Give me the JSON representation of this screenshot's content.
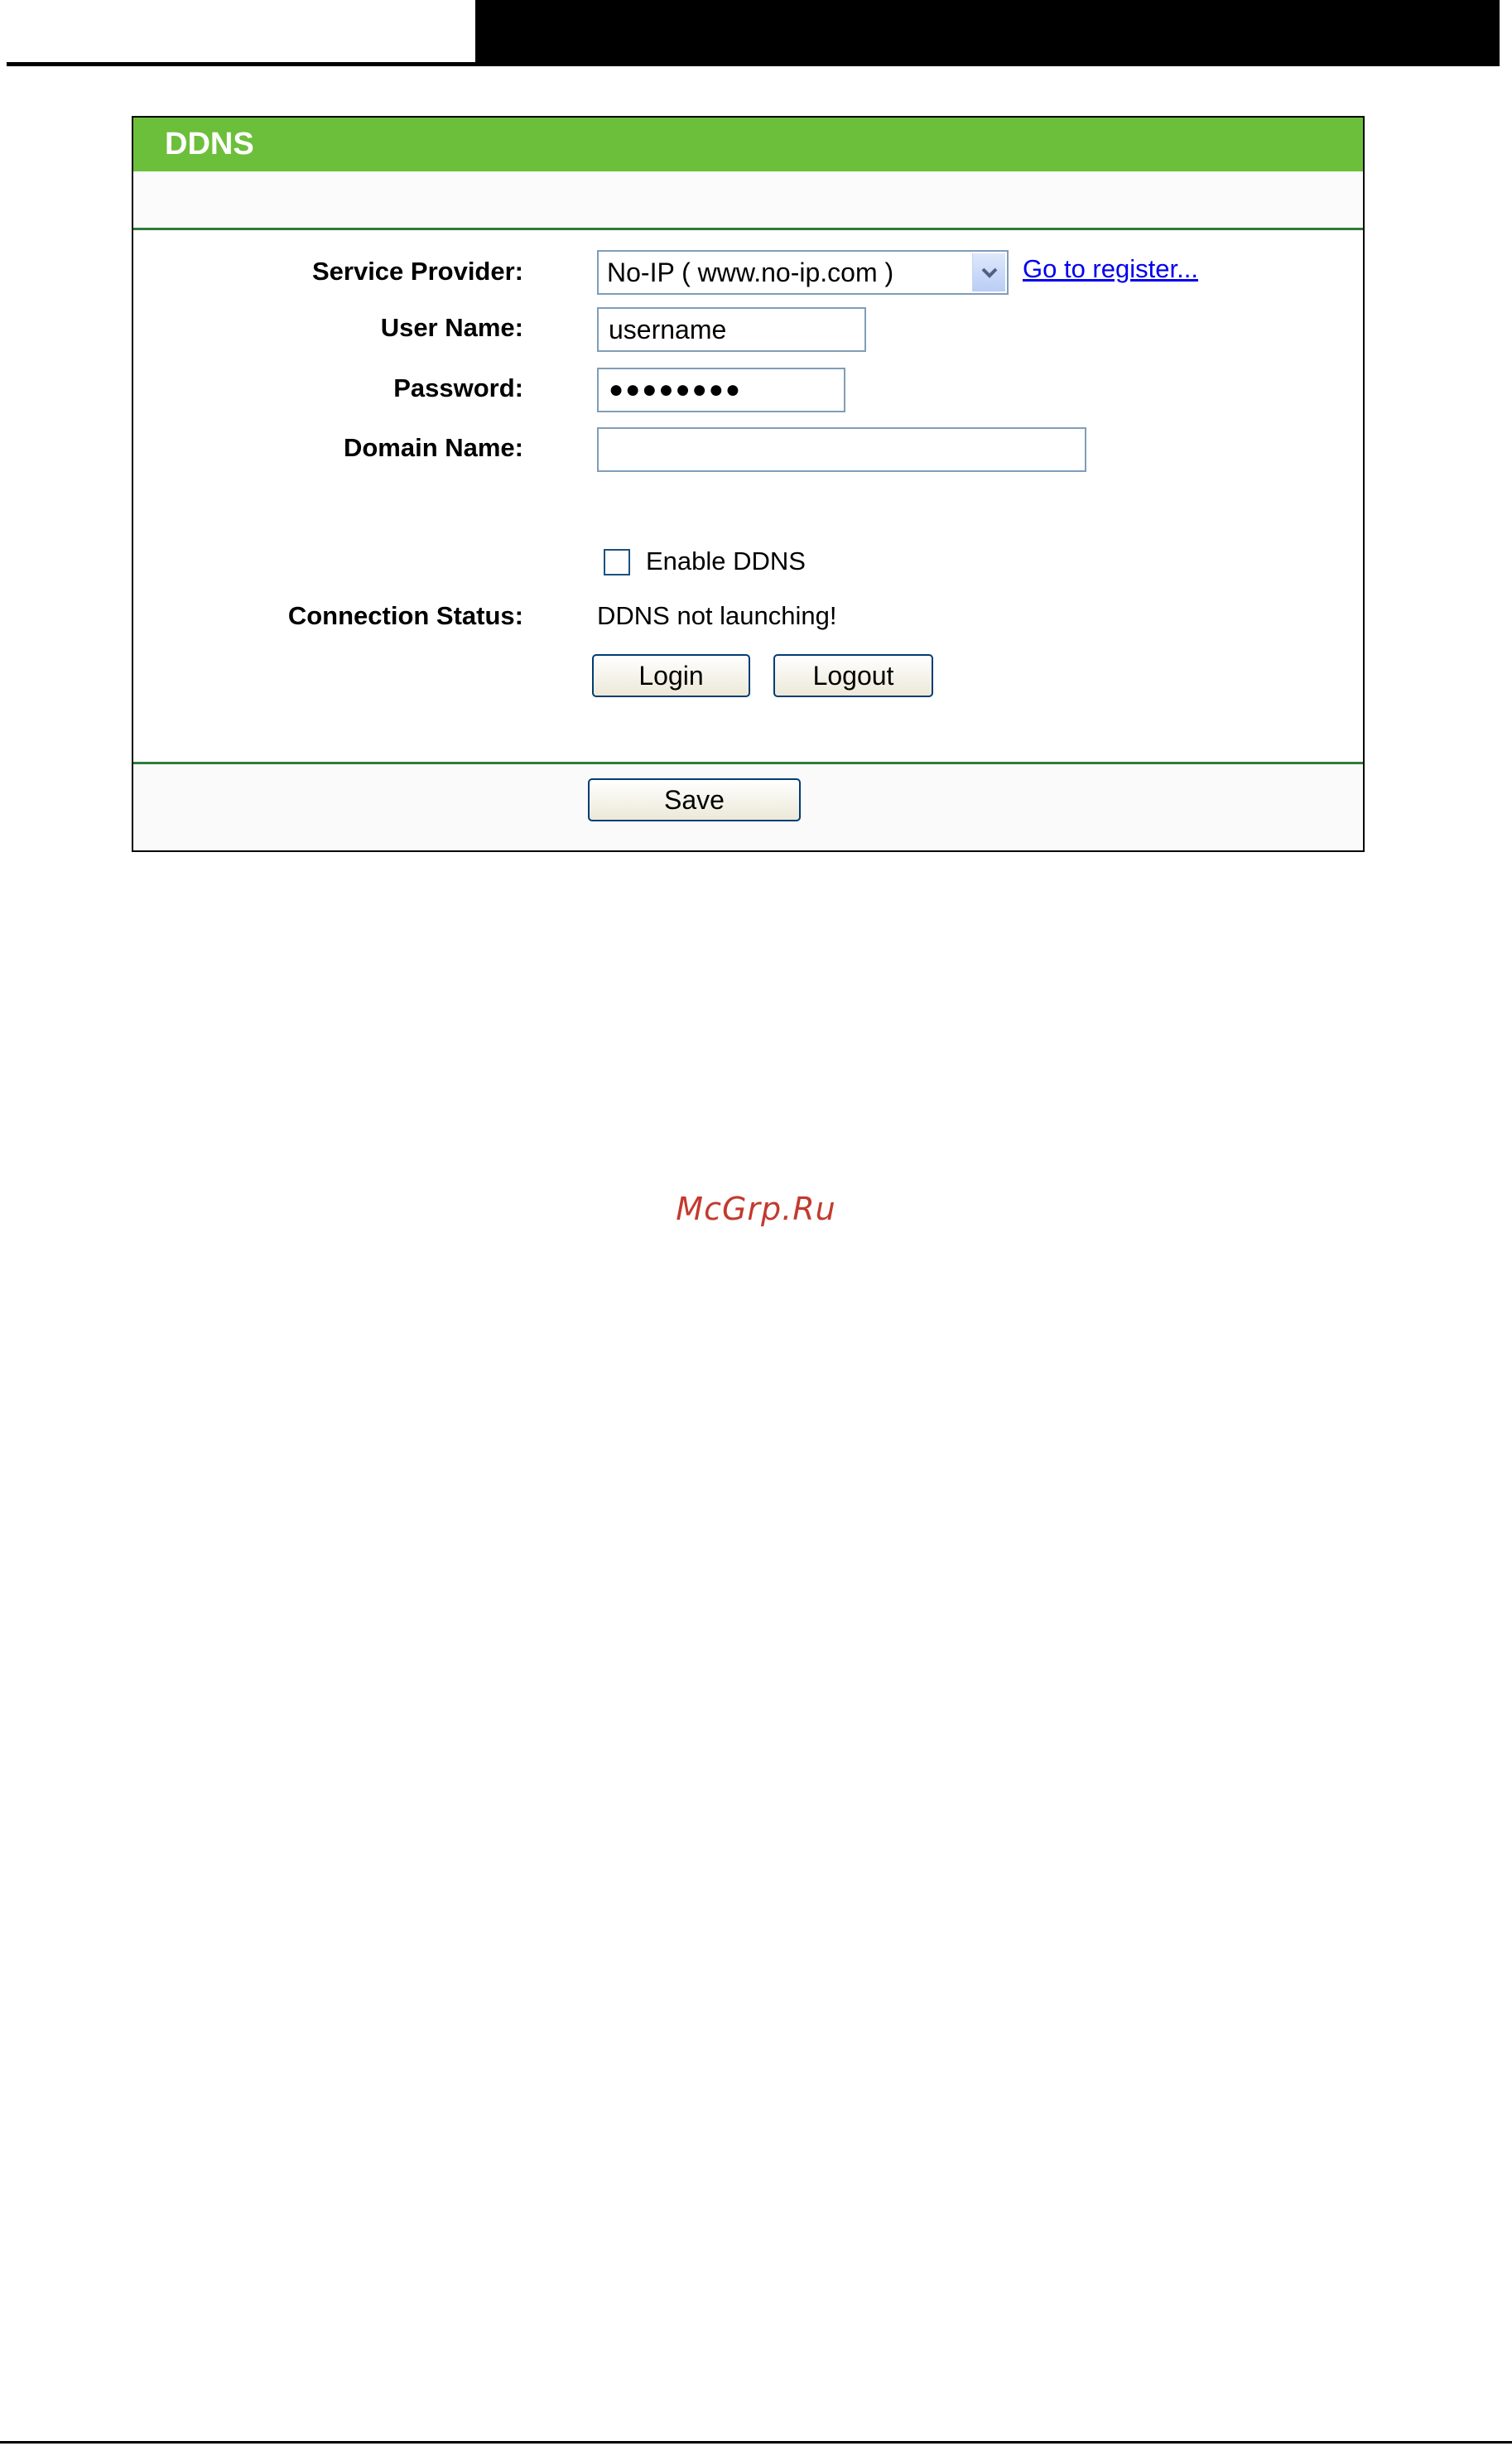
{
  "panel": {
    "title": "DDNS",
    "fields": {
      "service_provider_label": "Service Provider:",
      "service_provider_value": "No-IP ( www.no-ip.com )",
      "register_link": "Go to register...",
      "user_name_label": "User Name:",
      "user_name_value": "username",
      "password_label": "Password:",
      "password_value": "●●●●●●●●",
      "domain_name_label": "Domain Name:",
      "domain_name_value": "",
      "enable_ddns_label": "Enable DDNS",
      "enable_ddns_checked": false,
      "connection_status_label": "Connection Status:",
      "connection_status_value": "DDNS not launching!"
    },
    "buttons": {
      "login": "Login",
      "logout": "Logout",
      "save": "Save"
    }
  },
  "watermark": "McGrp.Ru",
  "colors": {
    "header_green": "#6cbf3a",
    "rule_green": "#2f7a3a",
    "link_blue": "#0000ee",
    "watermark_red": "#c33a2e"
  },
  "icons": {
    "select_arrow": "chevron-down-icon"
  }
}
